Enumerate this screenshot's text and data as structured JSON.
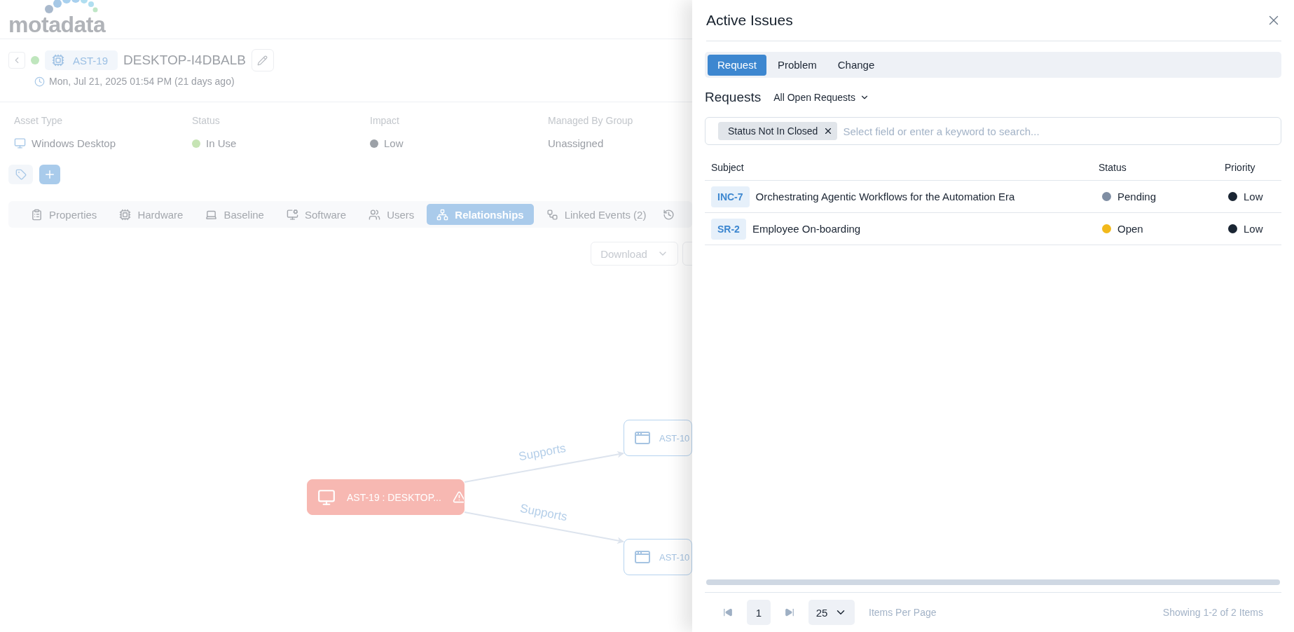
{
  "logo": {
    "text": "motadata"
  },
  "asset": {
    "id": "AST-19",
    "name": "DESKTOP-I4DBALB",
    "timestamp": "Mon, Jul 21, 2025 01:54 PM (21 days ago)"
  },
  "fields": [
    {
      "label": "Asset Type",
      "value": "Windows Desktop",
      "kind": "icon"
    },
    {
      "label": "Status",
      "value": "In Use",
      "kind": "dot",
      "color": "#c6e4b4"
    },
    {
      "label": "Impact",
      "value": "Low",
      "kind": "dot",
      "color": "#9ca1a7"
    },
    {
      "label": "Managed By Group",
      "value": "Unassigned",
      "kind": "plain"
    }
  ],
  "tabs": [
    {
      "label": "Properties",
      "selected": false
    },
    {
      "label": "Hardware",
      "selected": false
    },
    {
      "label": "Baseline",
      "selected": false
    },
    {
      "label": "Software",
      "selected": false
    },
    {
      "label": "Users",
      "selected": false
    },
    {
      "label": "Relationships",
      "selected": true
    },
    {
      "label": "Linked Events (2)",
      "selected": false
    }
  ],
  "toolbar": {
    "download": "Download"
  },
  "graph": {
    "nodes": [
      {
        "label": "AST-19 : DESKTOP...",
        "kind": "alert"
      },
      {
        "label": "AST-10",
        "kind": "software"
      },
      {
        "label": "AST-10",
        "kind": "software"
      }
    ],
    "edges": [
      {
        "label": "Supports"
      },
      {
        "label": "Supports"
      }
    ]
  },
  "panel": {
    "title": "Active Issues",
    "tabs": [
      {
        "label": "Request",
        "selected": true
      },
      {
        "label": "Problem",
        "selected": false
      },
      {
        "label": "Change",
        "selected": false
      }
    ],
    "heading": "Requests",
    "filter": "All Open Requests",
    "search": {
      "chip": "Status Not In Closed",
      "placeholder": "Select field or enter a keyword to search..."
    },
    "columns": [
      "Subject",
      "Status",
      "Priority"
    ],
    "rows": [
      {
        "id": "INC-7",
        "subject": "Orchestrating Agentic Workflows for the Automation Era",
        "status": {
          "text": "Pending",
          "color": "#7f8ea3"
        },
        "priority": {
          "text": "Low",
          "color": "#1a2533"
        }
      },
      {
        "id": "SR-2",
        "subject": "Employee On-boarding",
        "status": {
          "text": "Open",
          "color": "#f2b91b"
        },
        "priority": {
          "text": "Low",
          "color": "#1a2533"
        }
      }
    ],
    "pagination": {
      "page": "1",
      "page_size": "25",
      "page_size_label": "Items Per Page",
      "summary": "Showing 1-2 of 2 Items"
    }
  }
}
